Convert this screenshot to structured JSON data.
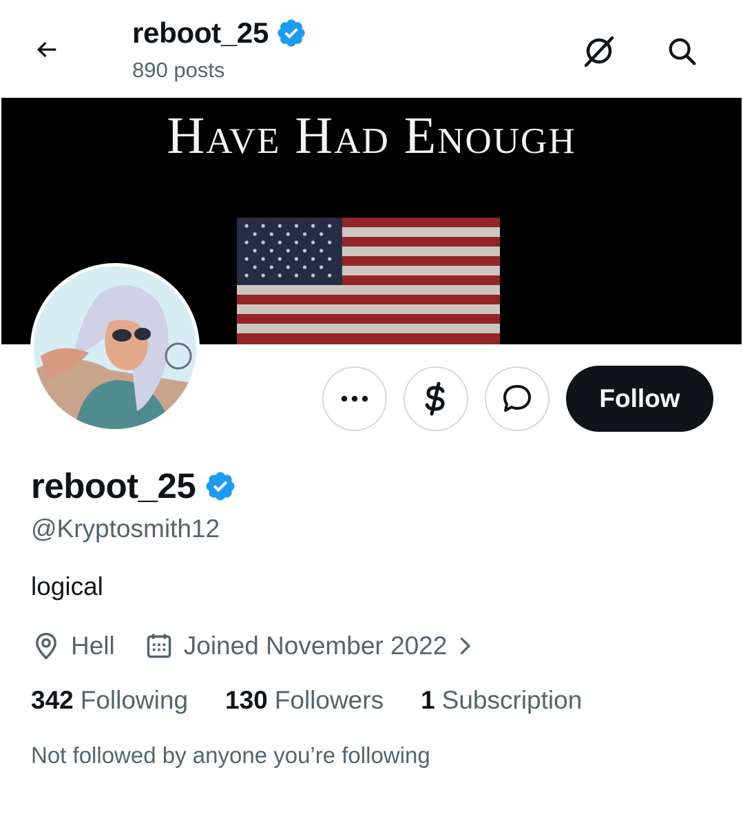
{
  "header": {
    "name": "reboot_25",
    "posts_count": "890 posts"
  },
  "banner": {
    "text": "Have Had Enough"
  },
  "actions": {
    "follow_label": "Follow"
  },
  "profile": {
    "display_name": "reboot_25",
    "handle": "@Kryptosmith12",
    "bio": "logical",
    "location": "Hell",
    "joined": "Joined November 2022"
  },
  "stats": {
    "following_count": "342",
    "following_label": "Following",
    "followers_count": "130",
    "followers_label": "Followers",
    "subscriptions_count": "1",
    "subscriptions_label": "Subscription"
  },
  "social_context": "Not followed by anyone you’re following",
  "icons": {
    "back": "arrow-left-icon",
    "grok": "grok-icon",
    "search": "search-icon",
    "verified": "verified-badge-icon",
    "more": "more-dots-icon",
    "tip": "dollar-icon",
    "message": "message-icon",
    "location": "location-pin-icon",
    "calendar": "calendar-icon",
    "chevron": "chevron-right-icon"
  },
  "colors": {
    "verified_blue": "#1d9bf0",
    "text_primary": "#0f1419",
    "text_secondary": "#536471",
    "border": "#cfd9de",
    "follow_bg": "#0f1419"
  }
}
